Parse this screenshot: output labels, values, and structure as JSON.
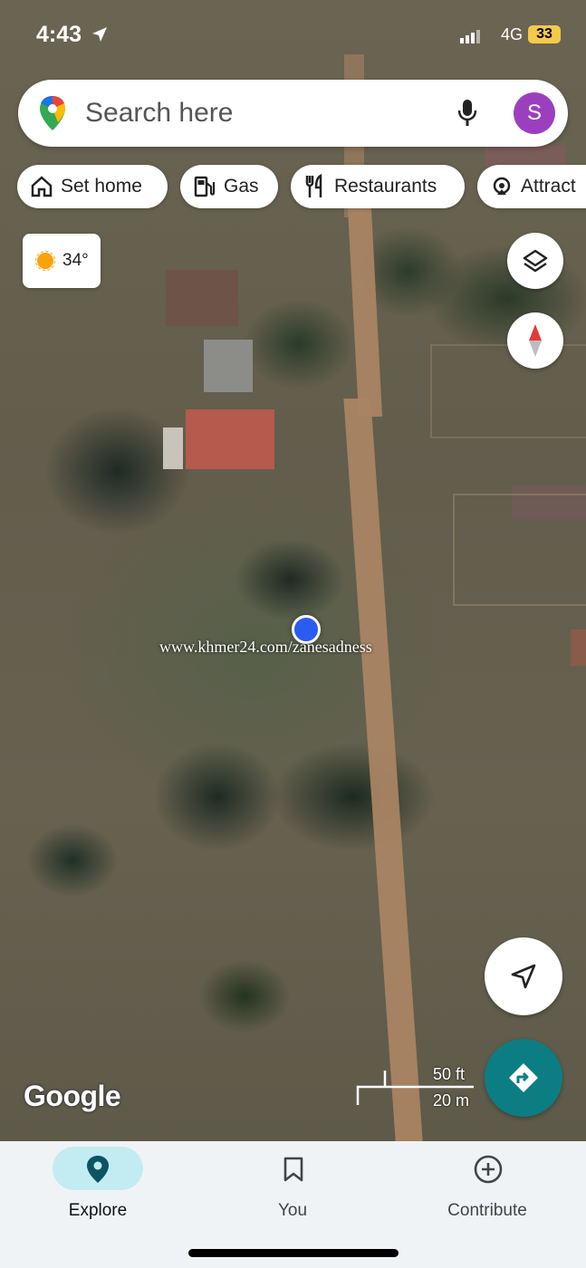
{
  "status_bar": {
    "time": "4:43",
    "network": "4G",
    "battery": "33"
  },
  "search": {
    "placeholder": "Search here",
    "avatar_letter": "S"
  },
  "chips": [
    {
      "label": "Set home",
      "icon": "home-icon"
    },
    {
      "label": "Gas",
      "icon": "gas-station-icon"
    },
    {
      "label": "Restaurants",
      "icon": "restaurant-icon"
    },
    {
      "label": "Attract",
      "icon": "attractions-icon"
    }
  ],
  "weather": {
    "temperature": "34°",
    "icon": "sun-icon"
  },
  "map": {
    "watermark": "www.khmer24.com/zanesadness",
    "logo": "Google",
    "scale": {
      "imperial": "50 ft",
      "metric": "20 m"
    }
  },
  "bottom_nav": {
    "items": [
      {
        "label": "Explore",
        "icon": "explore-pin-icon",
        "active": true
      },
      {
        "label": "You",
        "icon": "bookmark-icon",
        "active": false
      },
      {
        "label": "Contribute",
        "icon": "plus-circle-icon",
        "active": false
      }
    ]
  },
  "colors": {
    "accent": "#137333",
    "directions_fab": "#0d7d84",
    "active_nav_pill": "#c3ecf2",
    "location_dot": "#2a5cf0",
    "avatar": "#9c3fbf"
  }
}
